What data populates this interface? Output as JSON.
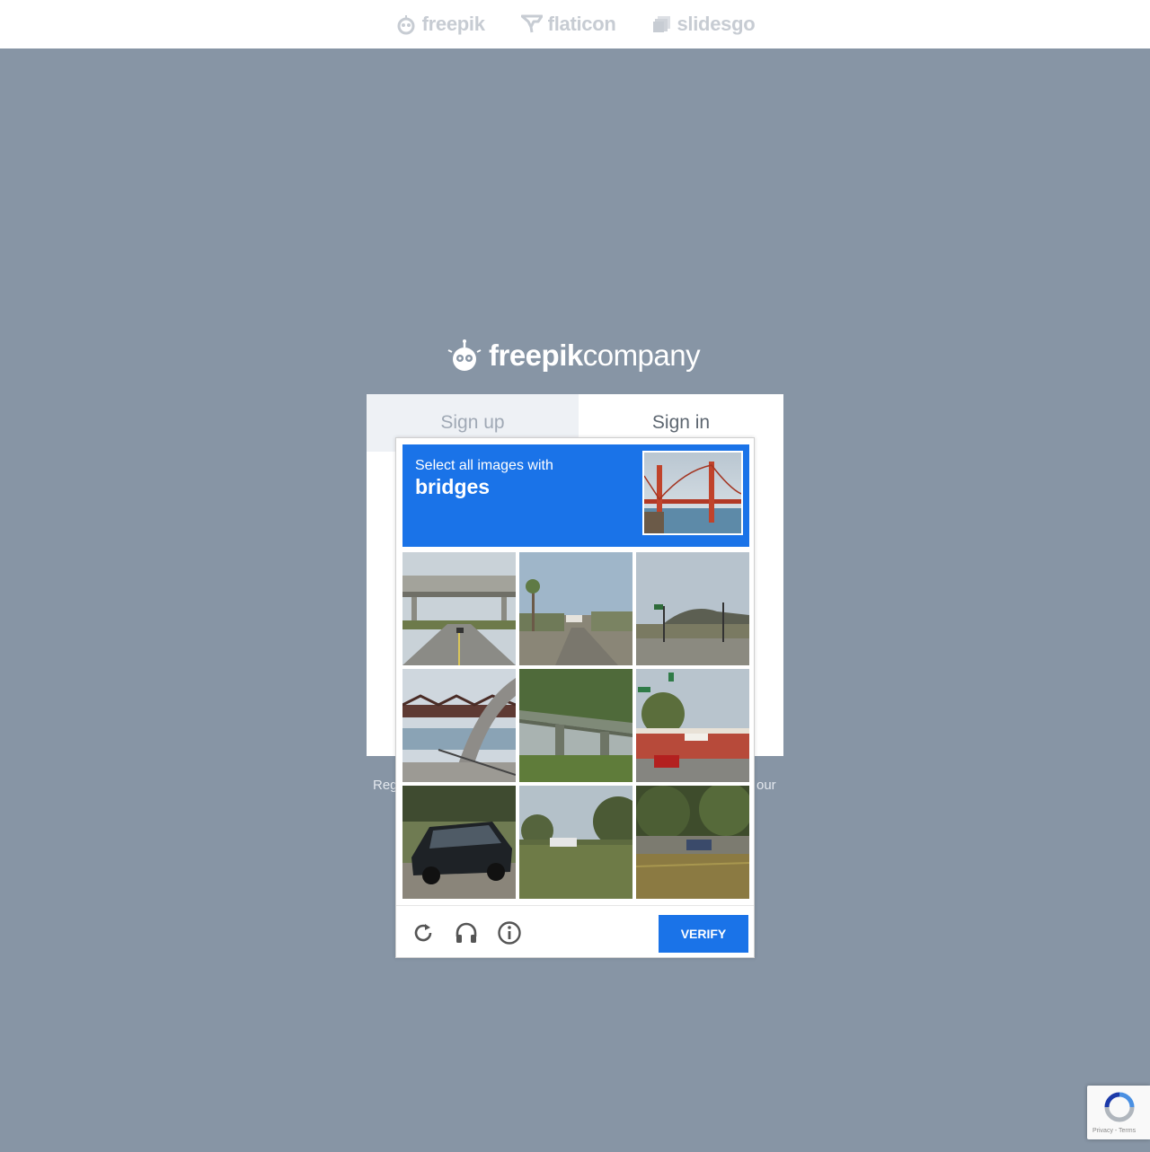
{
  "topbar": {
    "brands": [
      {
        "name": "freepik",
        "icon": "freepik-mascot-icon"
      },
      {
        "name": "flaticon",
        "icon": "flaticon-v-icon"
      },
      {
        "name": "slidesgo",
        "icon": "slidesgo-slides-icon"
      }
    ]
  },
  "main_logo": {
    "bold": "freepik",
    "light": "company"
  },
  "auth_card": {
    "tabs": [
      {
        "label": "Sign up",
        "active": false
      },
      {
        "label": "Sign in",
        "active": true
      }
    ],
    "below_left": "Reg",
    "below_right": "our"
  },
  "captcha": {
    "instruction": "Select all images with",
    "target": "bridges",
    "sample_image": "golden-gate-bridge",
    "tiles": [
      "highway-overpass",
      "suburban-street-palm",
      "rural-intersection",
      "steel-truss-bridge",
      "concrete-bridge-trees",
      "street-restaurant",
      "parked-car",
      "field-road-car",
      "road-car-trees"
    ],
    "footer": {
      "reload_icon": "reload-icon",
      "audio_icon": "headphones-icon",
      "info_icon": "info-icon",
      "verify_label": "VERIFY"
    }
  },
  "recaptcha_badge": {
    "links": "Privacy - Terms"
  },
  "colors": {
    "background": "#8795a5",
    "accent": "#1a73e8",
    "card": "#ffffff"
  }
}
